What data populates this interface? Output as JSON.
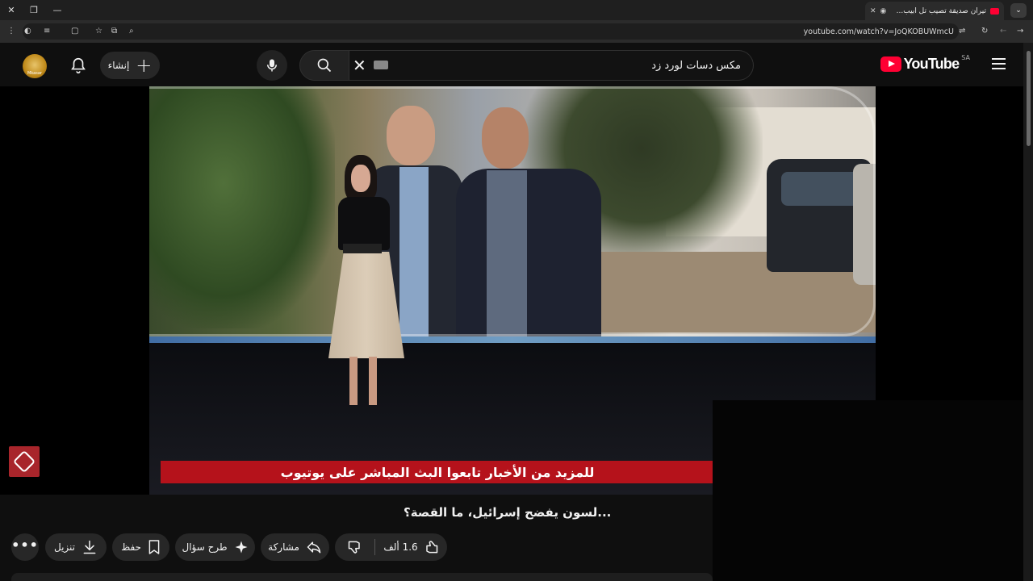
{
  "browser": {
    "tab_title": "تيران صديقة تصيب تل أبيب...",
    "url": "youtube.com/watch?v=JoQKOBUWmcU"
  },
  "header": {
    "logo_text": "YouTube",
    "country_code": "SA",
    "search_value": "مكس دسات لورد زد",
    "create_label": "إنشاء",
    "avatar_text": "Mkasar"
  },
  "video": {
    "ticker_text": "للمزيد من الأخبار تابعوا البث المباشر على يوتيوب"
  },
  "title": "...لسون يفضح إسرائيل، ما القصة؟",
  "actions": {
    "like_count": "1.6 ألف",
    "share_label": "مشاركة",
    "ask_label": "طرح سؤال",
    "save_label": "حفظ",
    "download_label": "تنزيل",
    "more_label": "•••"
  },
  "colors": {
    "brand_red": "#ff0033",
    "ticker_red": "#b5121b",
    "background": "#0f0f0f"
  }
}
